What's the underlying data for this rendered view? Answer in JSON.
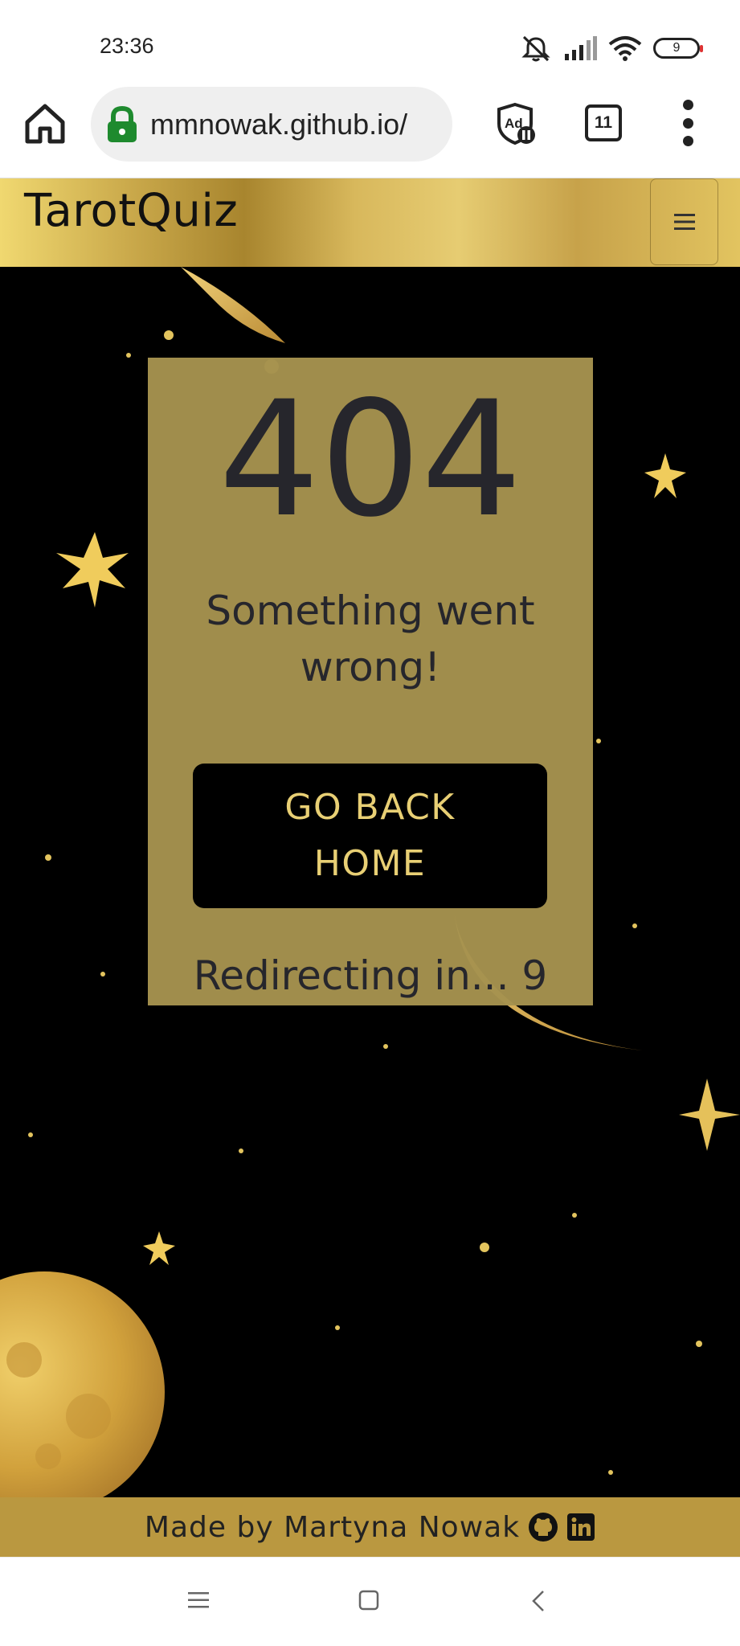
{
  "status_bar": {
    "time": "23:36",
    "battery_level": "9",
    "icons": [
      "mute-icon",
      "signal-icon",
      "wifi-icon",
      "battery-icon"
    ]
  },
  "browser": {
    "url": "mmnowak.github.io/",
    "tab_count": "11",
    "icons": [
      "home-icon",
      "lock-icon",
      "adblock-icon",
      "tabs-icon",
      "more-menu-icon"
    ]
  },
  "site": {
    "brand": "TarotQuiz",
    "nav_toggle_icon": "hamburger-icon"
  },
  "error_page": {
    "code": "404",
    "message": "Something went wrong!",
    "button_label": "GO BACK HOME",
    "redirect_text": "Redirecting in... 9"
  },
  "footer": {
    "text": "Made by Martyna Nowak",
    "icons": [
      "github-icon",
      "linkedin-icon"
    ]
  },
  "system_nav": {
    "icons": [
      "recents-icon",
      "home-square-icon",
      "back-icon"
    ]
  },
  "colors": {
    "gold": "#d8b85c",
    "card": "#a5924e",
    "button_text": "#e8cf74",
    "footer": "#ba9840",
    "background": "#000000"
  }
}
